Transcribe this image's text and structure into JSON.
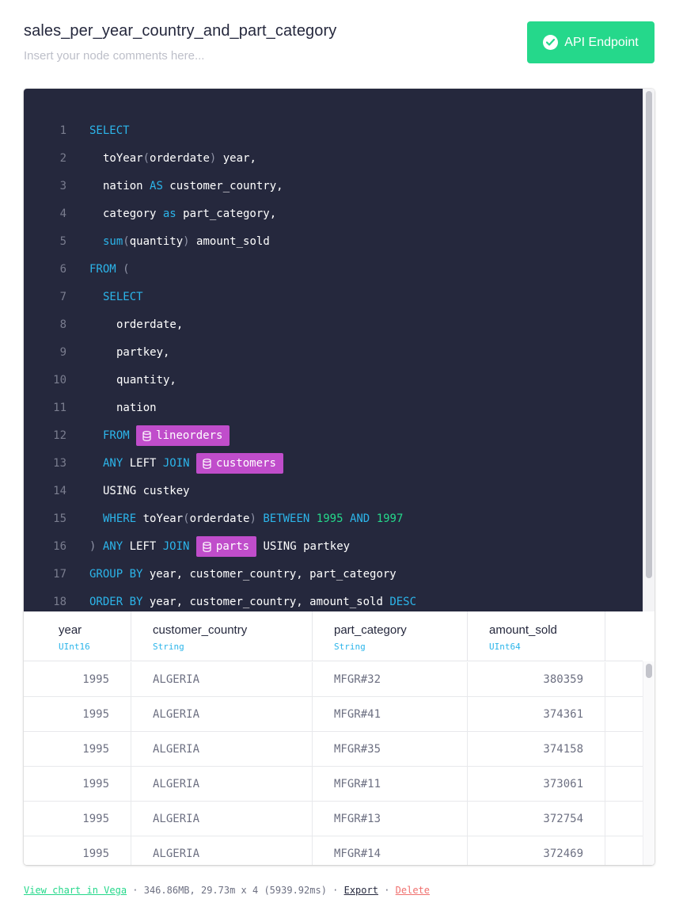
{
  "node": {
    "title": "sales_per_year_country_and_part_category",
    "comment_placeholder": "Insert your node comments here..."
  },
  "api_button": {
    "label": "API Endpoint"
  },
  "code_lines": [
    {
      "n": "1",
      "indent": 0,
      "tokens": [
        {
          "t": "SELECT",
          "c": "kw"
        }
      ]
    },
    {
      "n": "2",
      "indent": 1,
      "tokens": [
        {
          "t": "toYear",
          "c": "tok"
        },
        {
          "t": "(",
          "c": "pun"
        },
        {
          "t": "orderdate",
          "c": "tok"
        },
        {
          "t": ")",
          "c": "pun"
        },
        {
          "t": " year,",
          "c": "tok"
        }
      ]
    },
    {
      "n": "3",
      "indent": 1,
      "tokens": [
        {
          "t": "nation ",
          "c": "tok"
        },
        {
          "t": "AS",
          "c": "kw"
        },
        {
          "t": " customer_country,",
          "c": "tok"
        }
      ]
    },
    {
      "n": "4",
      "indent": 1,
      "tokens": [
        {
          "t": "category ",
          "c": "tok"
        },
        {
          "t": "as",
          "c": "kw"
        },
        {
          "t": " part_category,",
          "c": "tok"
        }
      ]
    },
    {
      "n": "5",
      "indent": 1,
      "tokens": [
        {
          "t": "sum",
          "c": "kw"
        },
        {
          "t": "(",
          "c": "pun"
        },
        {
          "t": "quantity",
          "c": "tok"
        },
        {
          "t": ")",
          "c": "pun"
        },
        {
          "t": " amount_sold",
          "c": "tok"
        }
      ]
    },
    {
      "n": "6",
      "indent": 0,
      "tokens": [
        {
          "t": "FROM",
          "c": "kw"
        },
        {
          "t": " (",
          "c": "pun"
        }
      ]
    },
    {
      "n": "7",
      "indent": 1,
      "tokens": [
        {
          "t": "SELECT",
          "c": "kw"
        }
      ]
    },
    {
      "n": "8",
      "indent": 2,
      "tokens": [
        {
          "t": "orderdate,",
          "c": "tok"
        }
      ]
    },
    {
      "n": "9",
      "indent": 2,
      "tokens": [
        {
          "t": "partkey,",
          "c": "tok"
        }
      ]
    },
    {
      "n": "10",
      "indent": 2,
      "tokens": [
        {
          "t": "quantity,",
          "c": "tok"
        }
      ]
    },
    {
      "n": "11",
      "indent": 2,
      "tokens": [
        {
          "t": "nation",
          "c": "tok"
        }
      ]
    },
    {
      "n": "12",
      "indent": 1,
      "tokens": [
        {
          "t": "FROM",
          "c": "kw"
        },
        {
          "t": " ",
          "c": "tok"
        },
        {
          "t": "lineorders",
          "c": "ds"
        }
      ]
    },
    {
      "n": "13",
      "indent": 1,
      "tokens": [
        {
          "t": "ANY",
          "c": "kw"
        },
        {
          "t": " LEFT ",
          "c": "tok"
        },
        {
          "t": "JOIN",
          "c": "kw"
        },
        {
          "t": " ",
          "c": "tok"
        },
        {
          "t": "customers",
          "c": "ds"
        }
      ]
    },
    {
      "n": "14",
      "indent": 1,
      "tokens": [
        {
          "t": "USING custkey",
          "c": "tok"
        }
      ]
    },
    {
      "n": "15",
      "indent": 1,
      "tokens": [
        {
          "t": "WHERE",
          "c": "kw"
        },
        {
          "t": " toYear",
          "c": "tok"
        },
        {
          "t": "(",
          "c": "pun"
        },
        {
          "t": "orderdate",
          "c": "tok"
        },
        {
          "t": ")",
          "c": "pun"
        },
        {
          "t": " ",
          "c": "tok"
        },
        {
          "t": "BETWEEN",
          "c": "kw"
        },
        {
          "t": " ",
          "c": "tok"
        },
        {
          "t": "1995",
          "c": "num"
        },
        {
          "t": " ",
          "c": "tok"
        },
        {
          "t": "AND",
          "c": "kw"
        },
        {
          "t": " ",
          "c": "tok"
        },
        {
          "t": "1997",
          "c": "num"
        }
      ]
    },
    {
      "n": "16",
      "indent": 0,
      "tokens": [
        {
          "t": ")",
          "c": "pun"
        },
        {
          "t": " ",
          "c": "tok"
        },
        {
          "t": "ANY",
          "c": "kw"
        },
        {
          "t": " LEFT ",
          "c": "tok"
        },
        {
          "t": "JOIN",
          "c": "kw"
        },
        {
          "t": " ",
          "c": "tok"
        },
        {
          "t": "parts",
          "c": "ds"
        },
        {
          "t": " USING partkey",
          "c": "tok"
        }
      ]
    },
    {
      "n": "17",
      "indent": 0,
      "tokens": [
        {
          "t": "GROUP BY",
          "c": "kw"
        },
        {
          "t": " year, customer_country, part_category",
          "c": "tok"
        }
      ]
    },
    {
      "n": "18",
      "indent": 0,
      "tokens": [
        {
          "t": "ORDER BY",
          "c": "kw"
        },
        {
          "t": " year, customer_country, amount_sold ",
          "c": "tok"
        },
        {
          "t": "DESC",
          "c": "kw"
        }
      ]
    }
  ],
  "columns": [
    {
      "name": "year",
      "type": "UInt16",
      "align": "right"
    },
    {
      "name": "customer_country",
      "type": "String",
      "align": "left"
    },
    {
      "name": "part_category",
      "type": "String",
      "align": "left"
    },
    {
      "name": "amount_sold",
      "type": "UInt64",
      "align": "right"
    }
  ],
  "rows": [
    [
      "1995",
      "ALGERIA",
      "MFGR#32",
      "380359"
    ],
    [
      "1995",
      "ALGERIA",
      "MFGR#41",
      "374361"
    ],
    [
      "1995",
      "ALGERIA",
      "MFGR#35",
      "374158"
    ],
    [
      "1995",
      "ALGERIA",
      "MFGR#11",
      "373061"
    ],
    [
      "1995",
      "ALGERIA",
      "MFGR#13",
      "372754"
    ],
    [
      "1995",
      "ALGERIA",
      "MFGR#14",
      "372469"
    ]
  ],
  "footer": {
    "chart_link": "View chart in Vega",
    "sep": " · ",
    "stats": "346.86MB, 29.73m x 4 (5939.92ms)",
    "export_link": "Export",
    "delete_link": "Delete"
  },
  "colors": {
    "editor_bg": "#25283d",
    "keyword": "#2cb5ea",
    "number": "#25d88b",
    "datasource_tag": "#c04dcb",
    "api_button": "#25d88b",
    "delete": "#f0706e"
  }
}
